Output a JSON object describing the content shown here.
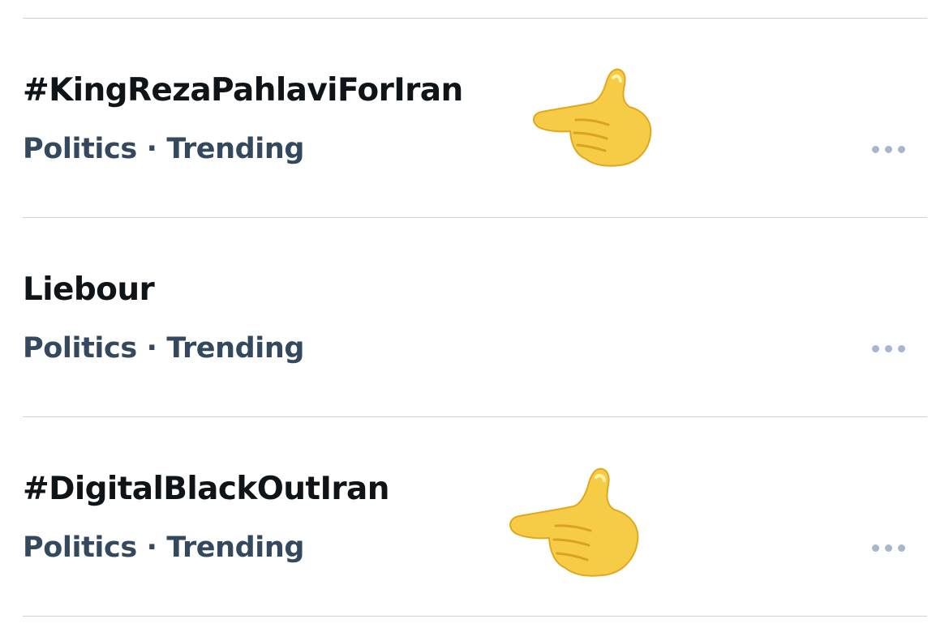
{
  "trends": [
    {
      "title": "#KingRezaPahlaviForIran",
      "category": "Politics",
      "separator": "·",
      "status": "Trending",
      "more_icon": "ellipsis-icon",
      "emoji": "backhand-index-pointing-left"
    },
    {
      "title": "Liebour",
      "category": "Politics",
      "separator": "·",
      "status": "Trending",
      "more_icon": "ellipsis-icon"
    },
    {
      "title": "#DigitalBlackOutIran",
      "category": "Politics",
      "separator": "·",
      "status": "Trending",
      "more_icon": "ellipsis-icon",
      "emoji": "backhand-index-pointing-left"
    }
  ],
  "colors": {
    "title": "#0f1419",
    "meta": "#34485e",
    "divider": "#cfd3d7",
    "more_dots": "#a6b9cc",
    "emoji_skin": "#f6cb45"
  }
}
